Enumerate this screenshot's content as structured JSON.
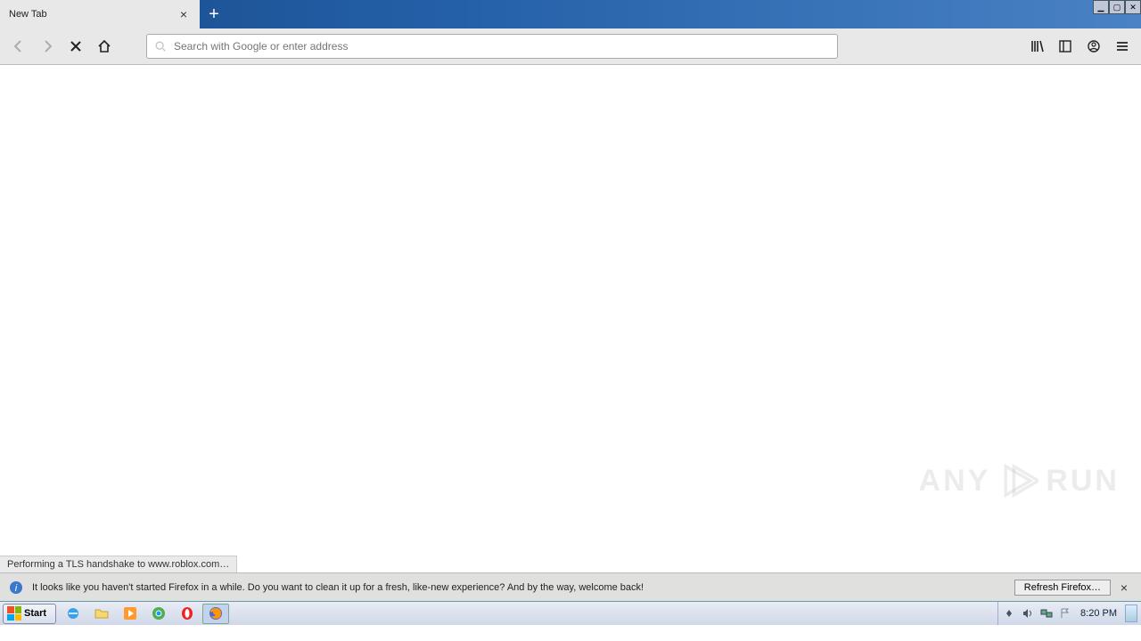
{
  "tab": {
    "title": "New Tab"
  },
  "addressbar": {
    "placeholder": "Search with Google or enter address"
  },
  "status": {
    "text": "Performing a TLS handshake to www.roblox.com…"
  },
  "notification": {
    "message": "It looks like you haven't started Firefox in a while. Do you want to clean it up for a fresh, like-new experience? And by the way, welcome back!",
    "button": "Refresh Firefox…"
  },
  "taskbar": {
    "start": "Start",
    "clock": "8:20 PM"
  },
  "watermark": "ANY    RUN"
}
